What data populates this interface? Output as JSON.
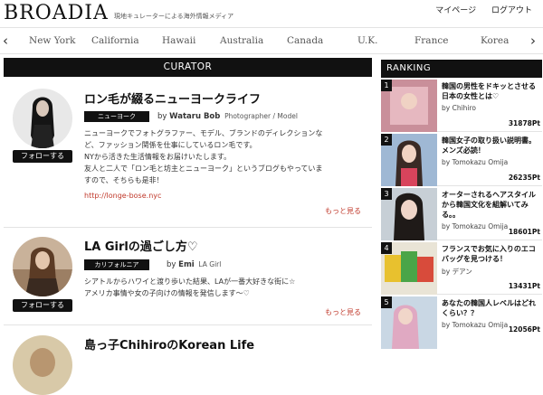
{
  "header": {
    "logo": "BROADIA",
    "tagline": "現地キュレーターによる海外情報メディア",
    "mypage": "マイページ",
    "logout": "ログアウト"
  },
  "countries": {
    "prev": "‹",
    "next": "›",
    "items": [
      "New York",
      "California",
      "Hawaii",
      "Australia",
      "Canada",
      "U.K.",
      "France",
      "Korea"
    ]
  },
  "curator": {
    "heading": "CURATOR",
    "follow_label": "フォローする",
    "more_label": "もっと見る",
    "by": "by",
    "cards": [
      {
        "title": "ロン毛が綴るニューヨークライフ",
        "badge": "ニューヨーク",
        "name": "Wataru Bob",
        "role": "Photographer / Model",
        "desc1": "ニューヨークでフォトグラファー、モデル、ブランドのディレクションな",
        "desc2": "ど、ファッション関係を仕事にしているロン毛です。",
        "desc3": "NYから活きた生活情報をお届けいたします。",
        "desc4": "友人と二人で「ロン毛と坊主とニューヨーク」というブログもやっていま",
        "desc5": "すので、そちらも是非！",
        "url": "http://longe-bose.nyc"
      },
      {
        "title": "LA Girlの過ごし方♡",
        "badge": "カリフォルニア",
        "name": "Emi",
        "role": "LA Girl",
        "desc1": "シアトルからハワイと渡り歩いた結果、LAが一番大好きな街に☆",
        "desc2": "アメリカ事情や女の子向けの情報を発信します〜♡"
      },
      {
        "title": "島っ子ChihiroのKorean Life"
      }
    ]
  },
  "ranking": {
    "heading": "RANKING",
    "items": [
      {
        "num": "1",
        "title": "韓国の男性をドキッとさせる日本の女性とは♡",
        "by": "by Chihiro",
        "views": "31878Pt"
      },
      {
        "num": "2",
        "title": "韓国女子の取り扱い説明書。メンズ必読！",
        "by": "by Tomokazu Omija",
        "views": "26235Pt"
      },
      {
        "num": "3",
        "title": "オーターされるヘアスタイルから韓国文化を組解いてみる。。",
        "by": "by Tomokazu Omija",
        "views": "18601Pt"
      },
      {
        "num": "4",
        "title": "フランスでお気に入りのエコバッグを見つける！",
        "by": "by デアン",
        "views": "13431Pt"
      },
      {
        "num": "5",
        "title": "あなたの韓国人レベルはどれくらい？？",
        "by": "by Tomokazu Omija",
        "views": "12056Pt"
      }
    ]
  }
}
